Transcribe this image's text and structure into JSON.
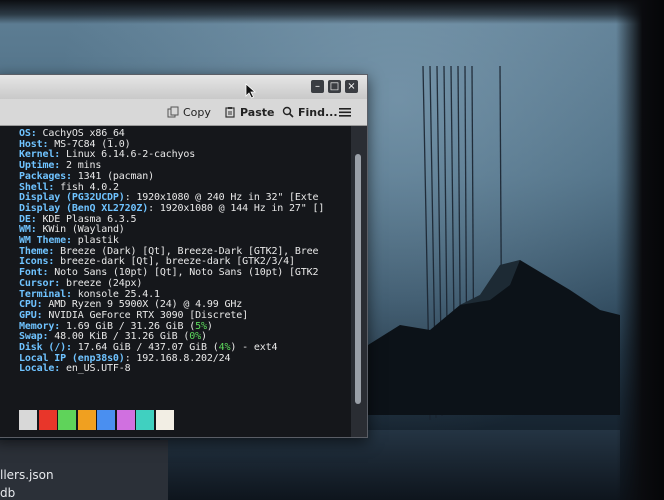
{
  "window": {
    "toolbar": {
      "copy_label": "Copy",
      "paste_label": "Paste",
      "find_label": "Find..."
    }
  },
  "terminal": {
    "lines": [
      {
        "key": "OS:",
        "value": " CachyOS x86_64"
      },
      {
        "key": "Host:",
        "value": " MS-7C84 (1.0)"
      },
      {
        "key": "Kernel:",
        "value": " Linux 6.14.6-2-cachyos"
      },
      {
        "key": "Uptime:",
        "value": " 2 mins"
      },
      {
        "key": "Packages:",
        "value": " 1341 (pacman)"
      },
      {
        "key": "Shell:",
        "value": " fish 4.0.2"
      },
      {
        "key": "Display ",
        "hl": "(PG32UCDP)",
        "value": ": 1920x1080 @ 240 Hz in 32\" [Exte"
      },
      {
        "key": "Display ",
        "hl": "(BenQ XL2720Z)",
        "value": ": 1920x1080 @ 144 Hz in 27\" []"
      },
      {
        "key": "DE:",
        "value": " KDE Plasma 6.3.5"
      },
      {
        "key": "WM:",
        "value": " KWin (Wayland)"
      },
      {
        "key": "WM Theme:",
        "value": " plastik"
      },
      {
        "key": "Theme:",
        "value": " Breeze (Dark) [Qt], Breeze-Dark [GTK2], Bree"
      },
      {
        "key": "Icons:",
        "value": " breeze-dark [Qt], breeze-dark [GTK2/3/4]"
      },
      {
        "key": "Font:",
        "value": " Noto Sans (10pt) [Qt], Noto Sans (10pt) [GTK2"
      },
      {
        "key": "Cursor:",
        "value": " breeze (24px)"
      },
      {
        "key": "Terminal:",
        "value": " konsole 25.4.1"
      },
      {
        "key": "CPU:",
        "value": " AMD Ryzen 9 5900X (24) @ 4.99 GHz"
      },
      {
        "key": "GPU:",
        "value": " NVIDIA GeForce RTX 3090 [Discrete]"
      },
      {
        "key": "Memory:",
        "value": " 1.69 GiB / 31.26 GiB (",
        "pct": "5%",
        "tail": ")"
      },
      {
        "key": "Swap:",
        "value": " 48.00 KiB / 31.26 GiB (",
        "pct": "0%",
        "tail": ")"
      },
      {
        "key": "Disk (/):",
        "value": " 17.64 GiB / 437.07 GiB (",
        "pct": "4%",
        "tail": ") - ext4"
      },
      {
        "key": "Local IP ",
        "hl": "(enp38s0)",
        "value": ": 192.168.8.202/24"
      },
      {
        "key": "Locale:",
        "value": " en_US.UTF-8"
      }
    ],
    "palette": [
      "#d8d8d8",
      "#e8362a",
      "#5fd35a",
      "#f0a020",
      "#4a8ff0",
      "#d070e0",
      "#40d0c0",
      "#f2eee4"
    ]
  },
  "dock": {
    "items": [
      "llers.json",
      "db"
    ]
  }
}
